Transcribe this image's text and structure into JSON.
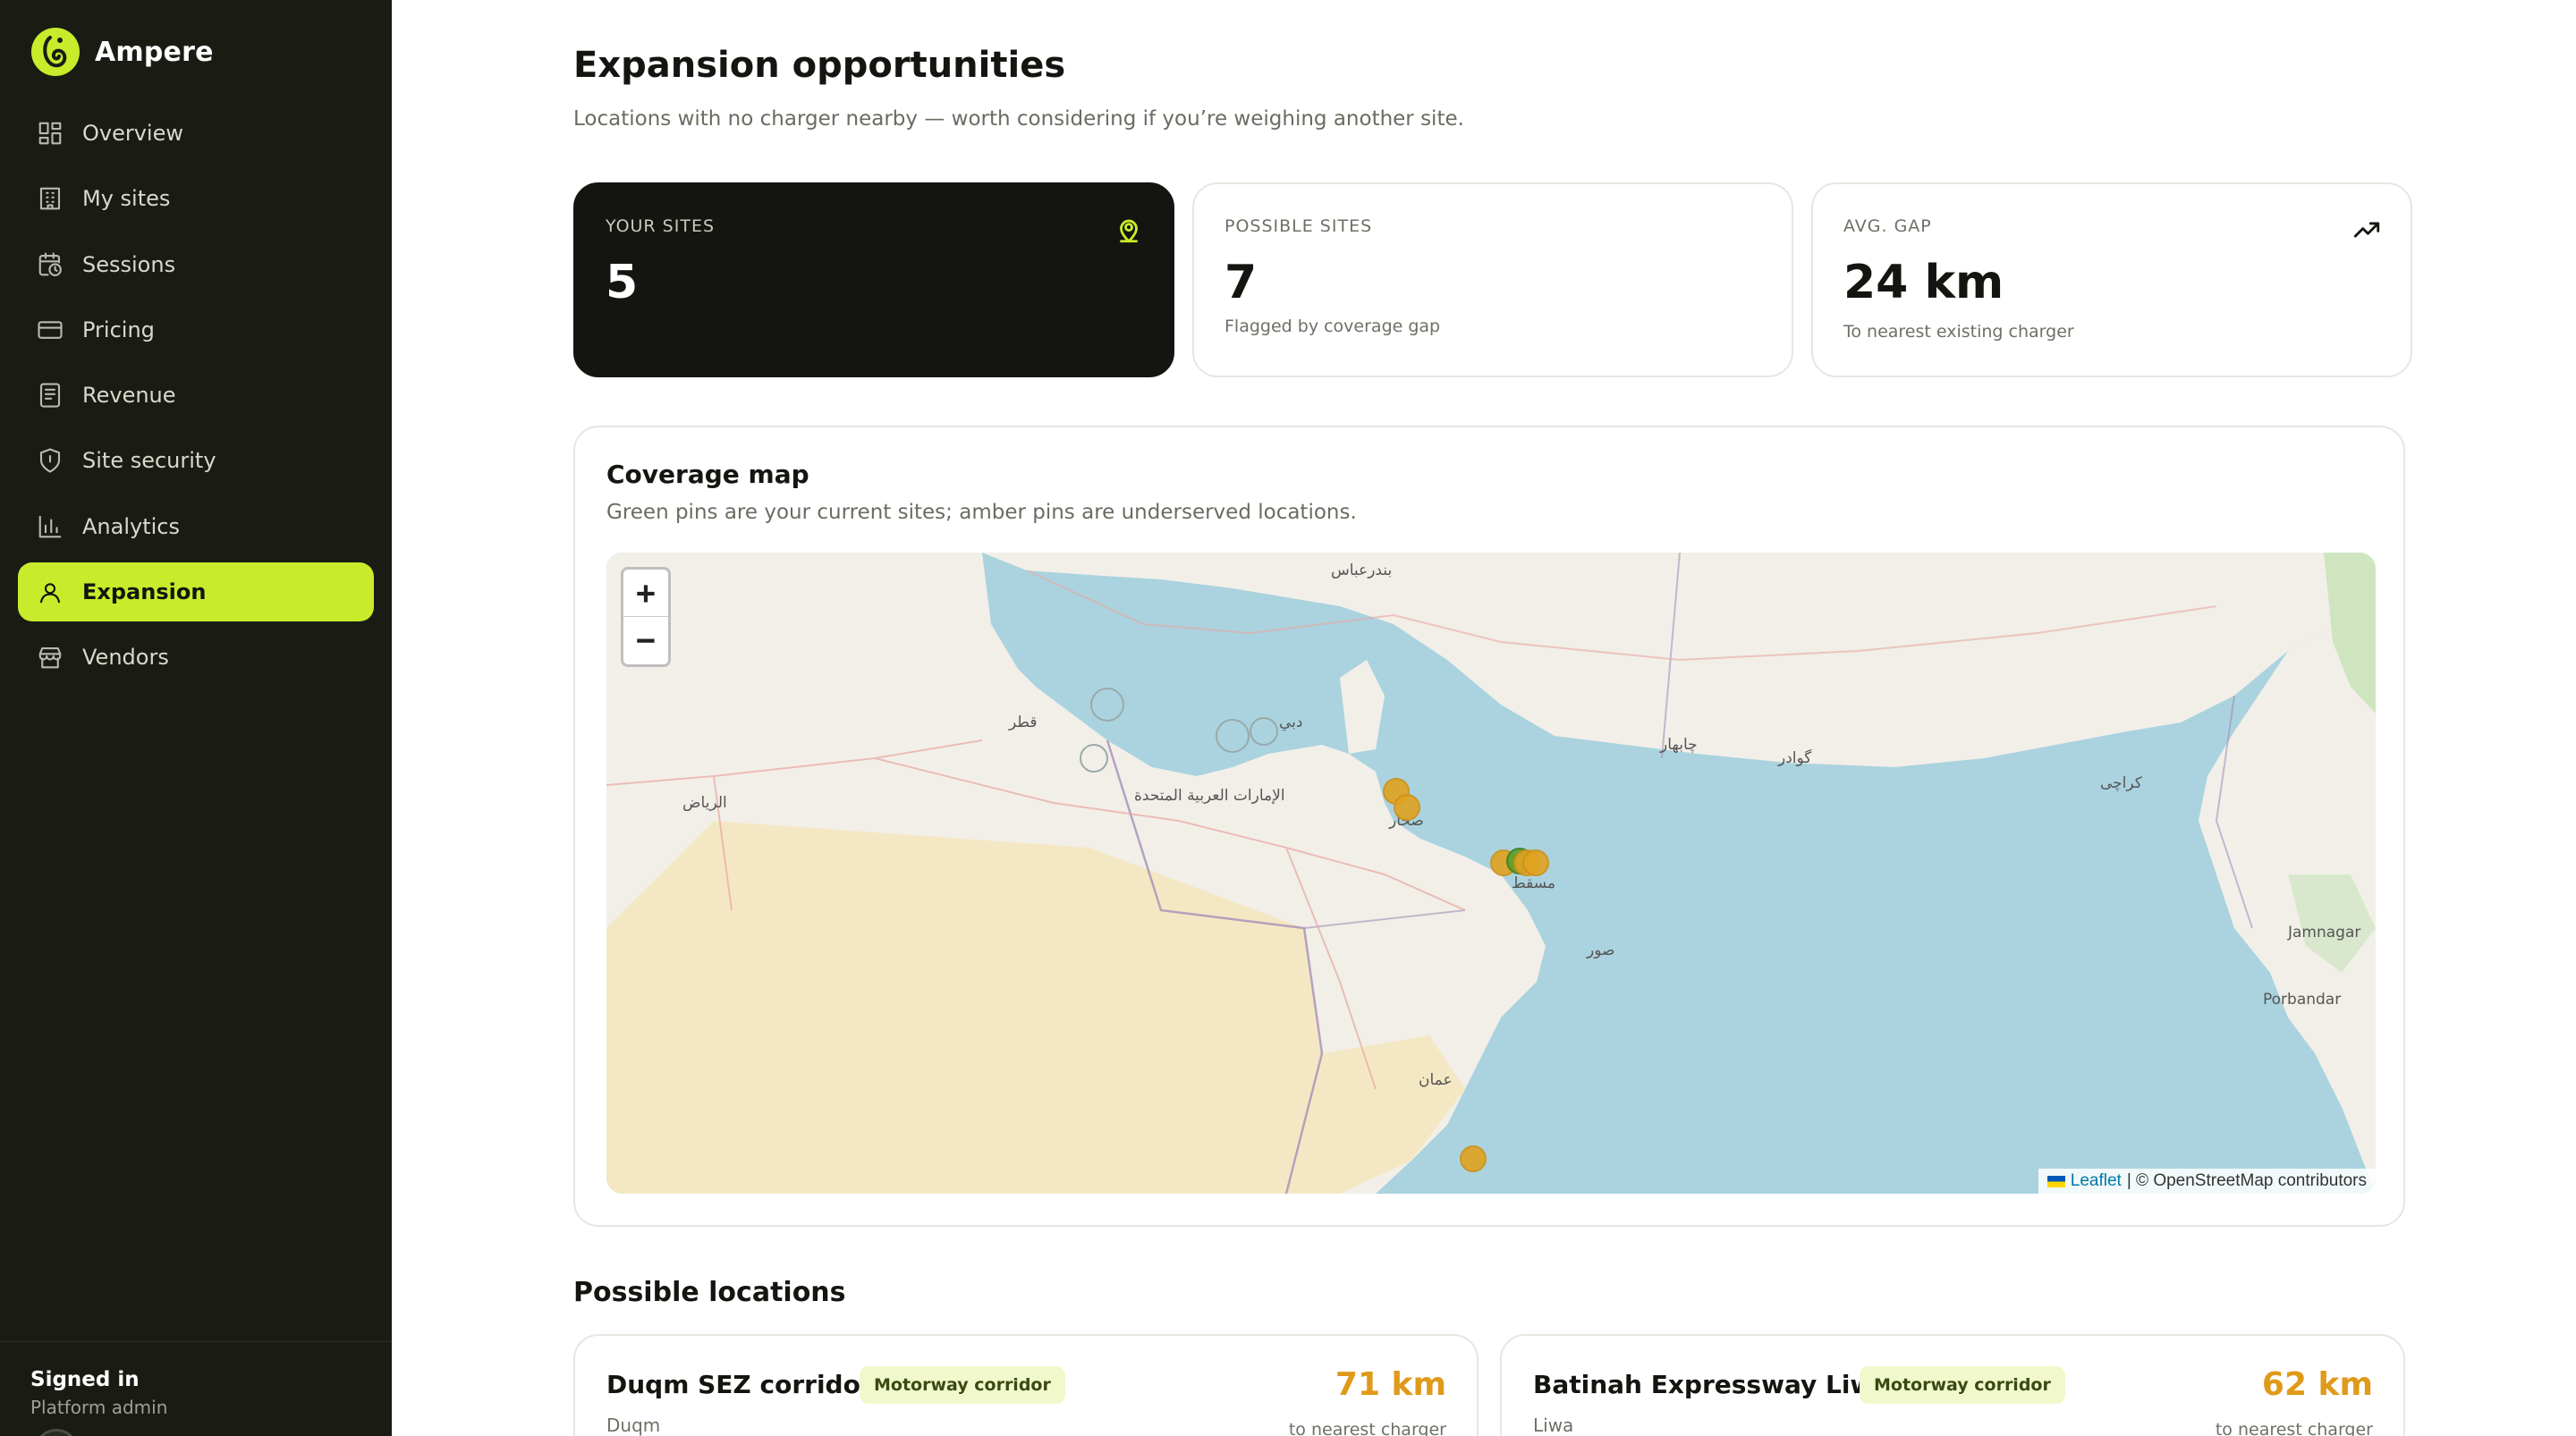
{
  "app": {
    "name": "Ampere"
  },
  "sidebar": {
    "items": [
      {
        "label": "Overview",
        "icon": "grid-icon"
      },
      {
        "label": "My sites",
        "icon": "building-icon"
      },
      {
        "label": "Sessions",
        "icon": "calendar-clock-icon"
      },
      {
        "label": "Pricing",
        "icon": "credit-card-icon"
      },
      {
        "label": "Revenue",
        "icon": "receipt-icon"
      },
      {
        "label": "Site security",
        "icon": "shield-icon"
      },
      {
        "label": "Analytics",
        "icon": "bar-chart-icon"
      },
      {
        "label": "Expansion",
        "icon": "map-pin-user-icon",
        "active": true
      },
      {
        "label": "Vendors",
        "icon": "store-icon"
      }
    ],
    "footer": {
      "title": "Signed in",
      "role": "Platform admin"
    }
  },
  "page": {
    "title": "Expansion opportunities",
    "subtitle": "Locations with no charger nearby — worth considering if you’re weighing another site."
  },
  "stats": {
    "your_sites": {
      "label": "YOUR SITES",
      "value": "5"
    },
    "possible_sites": {
      "label": "POSSIBLE SITES",
      "value": "7",
      "note": "Flagged by coverage gap"
    },
    "avg_gap": {
      "label": "AVG. GAP",
      "value": "24 km",
      "note": "To nearest existing charger"
    }
  },
  "map": {
    "title": "Coverage map",
    "subtitle": "Green pins are your current sites; amber pins are underserved locations.",
    "zoom_in": "+",
    "zoom_out": "−",
    "attribution_link": "Leaflet",
    "attribution_text": "| © OpenStreetMap contributors",
    "labels": {
      "dubai": "دبي",
      "muscat": "مسقط",
      "sohar": "صحار",
      "riyadh": "الرياض",
      "uae": "الإمارات العربية المتحدة",
      "karachi": "كراچی",
      "jamnagar": "Jamnagar",
      "porbandar": "Porbandar",
      "sur": "صور",
      "oman": "عمان",
      "doha": "قطر",
      "bandar_abbas": "بندرعباس",
      "gwadar": "گوادر",
      "chabahar": "چابهار"
    },
    "colors": {
      "site_pin": "#5aa02c",
      "gap_pin": "#e0a321",
      "sea": "#aad3df"
    }
  },
  "possible_locations": {
    "title": "Possible locations",
    "items": [
      {
        "name": "Duqm SEZ corridor",
        "badge": "Motorway corridor",
        "area": "Duqm",
        "distance": "71 km",
        "distance_note": "to nearest charger"
      },
      {
        "name": "Batinah Expressway Liwa",
        "badge": "Motorway corridor",
        "area": "Liwa",
        "distance": "62 km",
        "distance_note": "to nearest charger"
      }
    ]
  },
  "accent": "#c8ec2b"
}
